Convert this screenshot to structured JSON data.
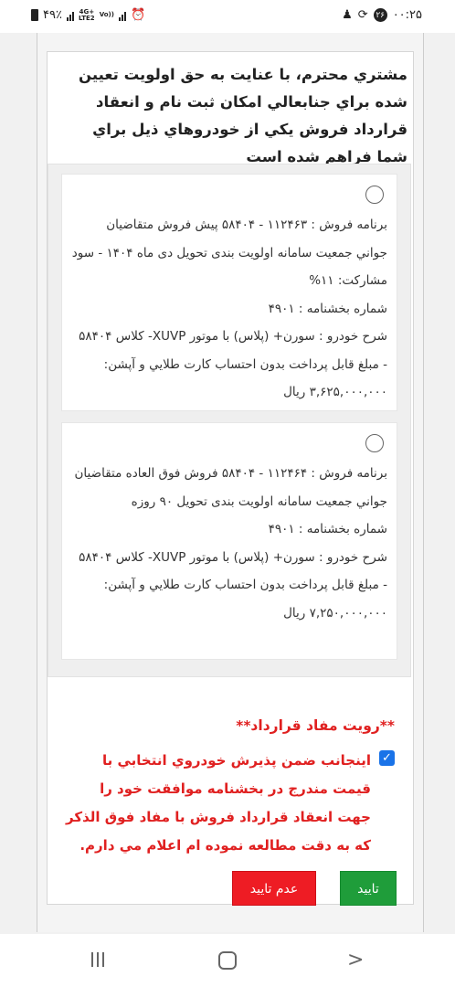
{
  "status_bar": {
    "time": "۰۰:۲۵",
    "notification_count": "۲۶",
    "battery_percent": "۴۹٪",
    "network_top": "4G+",
    "network_bottom": "LTE2",
    "volte_label": "Vo))"
  },
  "header": {
    "notice": "مشتري محترم، با عنايت به حق اولويت تعيين شده براي جنابعالي امكان ثبت نام و انعقاد قرارداد فروش يكي از خودروهاي ذيل براي شما فراهم شده است"
  },
  "options": [
    {
      "program": "برنامه فروش : ۱۱۲۴۶۳ - ۵۸۴۰۴ پيش فروش متقاضيان جواني جمعيت سامانه اولويت بندی تحويل دی ماه ۱۴۰۴ - سود مشارکت: ۱۱%",
      "circular": "شماره بخشنامه : ۴۹۰۱",
      "description": "شرح خودرو : سورن+ (پلاس) با موتور XUVP- کلاس ۵۸۴۰۴ - مبلغ قابل پرداخت بدون احتساب کارت طلايي و آپشن: ۳,۶۲۵,۰۰۰,۰۰۰ ريال",
      "selected": false
    },
    {
      "program": "برنامه فروش : ۱۱۲۴۶۴ - ۵۸۴۰۴ فروش فوق العاده متقاضيان جواني جمعيت سامانه اولويت بندی تحويل ۹۰ روزه",
      "circular": "شماره بخشنامه : ۴۹۰۱",
      "description": "شرح خودرو : سورن+ (پلاس) با موتور XUVP- کلاس ۵۸۴۰۴ - مبلغ قابل پرداخت بدون احتساب کارت طلايي و آپشن: ۷,۲۵۰,۰۰۰,۰۰۰ ريال",
      "selected": false
    }
  ],
  "consent": {
    "title": "**رويت مفاد قرارداد**",
    "checked": true,
    "text": "اينجانب ضمن پذيرش خودروي انتخابي با قيمت مندرج در بخشنامه موافقت خود را جهت انعقاد قرارداد فروش با مفاد فوق الذكر كه به دقت مطالعه نموده ام اعلام مي دارم."
  },
  "buttons": {
    "confirm_label": "تاييد",
    "reject_label": "عدم تاييد"
  },
  "colors": {
    "accent_red": "#e02020",
    "confirm_green": "#1f9d3a",
    "reject_red": "#ee1c24",
    "divider_blue": "#2b6cb0"
  },
  "nav": {
    "recents_icon": "recents-icon",
    "home_icon": "home-icon",
    "back_icon": "back-icon"
  }
}
